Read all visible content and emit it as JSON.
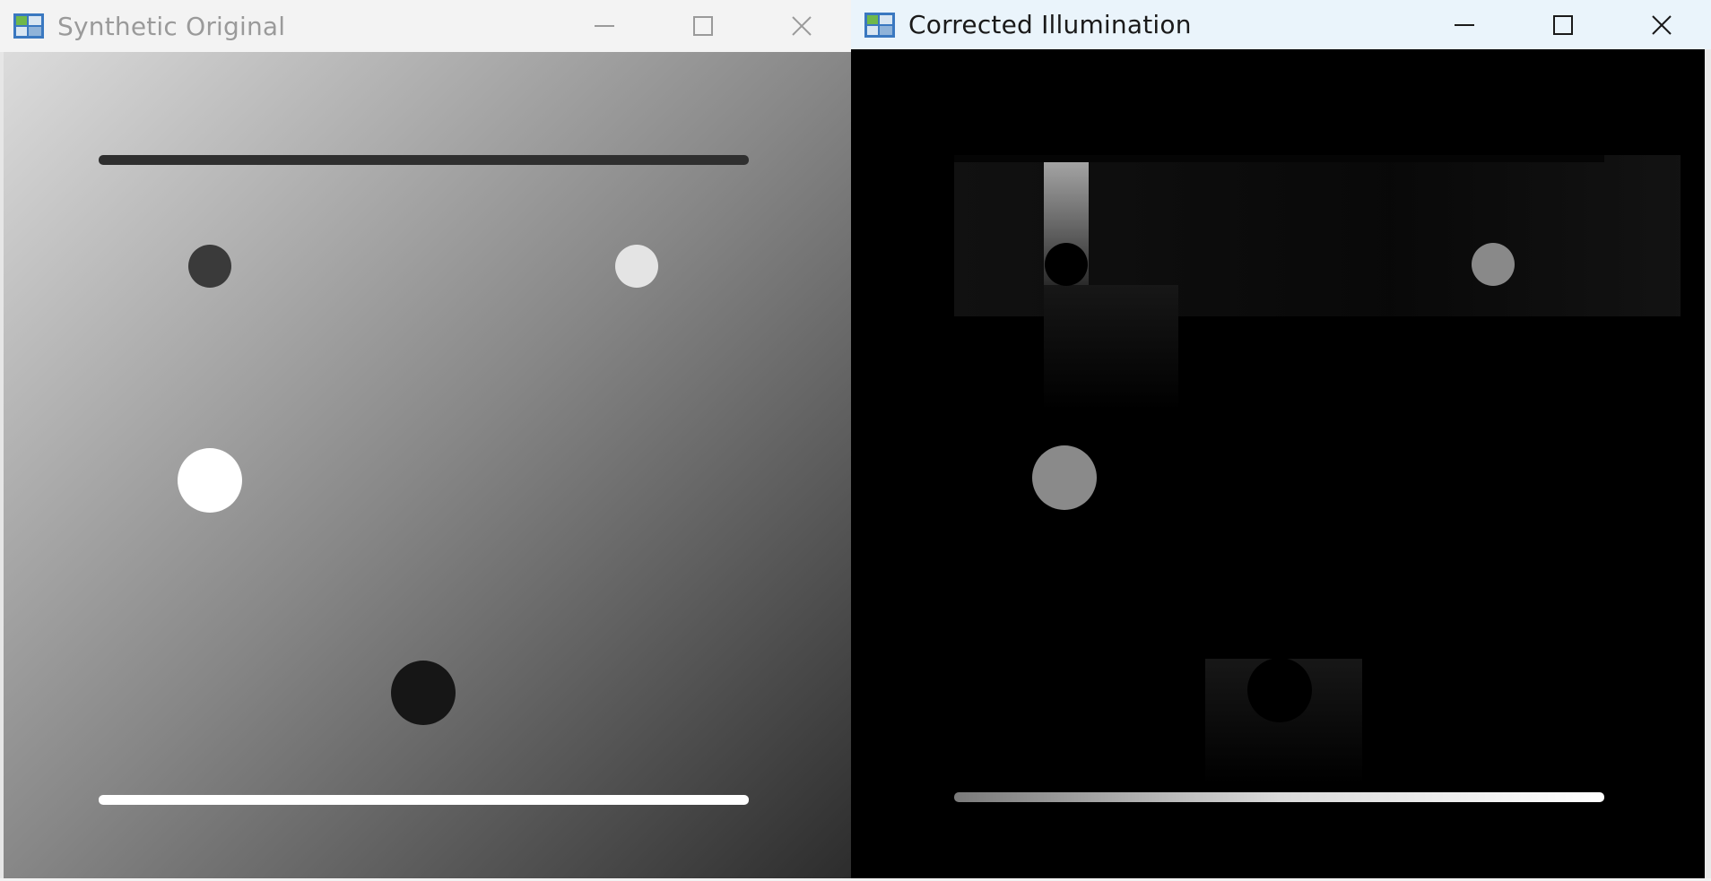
{
  "windows": {
    "left": {
      "title": "Synthetic Original",
      "icon": "image-window-icon",
      "controls": [
        "minimize-icon",
        "maximize-icon",
        "close-icon"
      ]
    },
    "right": {
      "title": "Corrected Illumination",
      "icon": "image-window-icon",
      "controls": [
        "minimize-icon",
        "maximize-icon",
        "close-icon"
      ]
    }
  },
  "colors": {
    "left_gradient_start": "#dcdcdc",
    "left_gradient_end": "#2c2c2c",
    "right_background": "#000000",
    "title_inactive": "#9a9a9a",
    "title_active": "#1a1a1a"
  }
}
